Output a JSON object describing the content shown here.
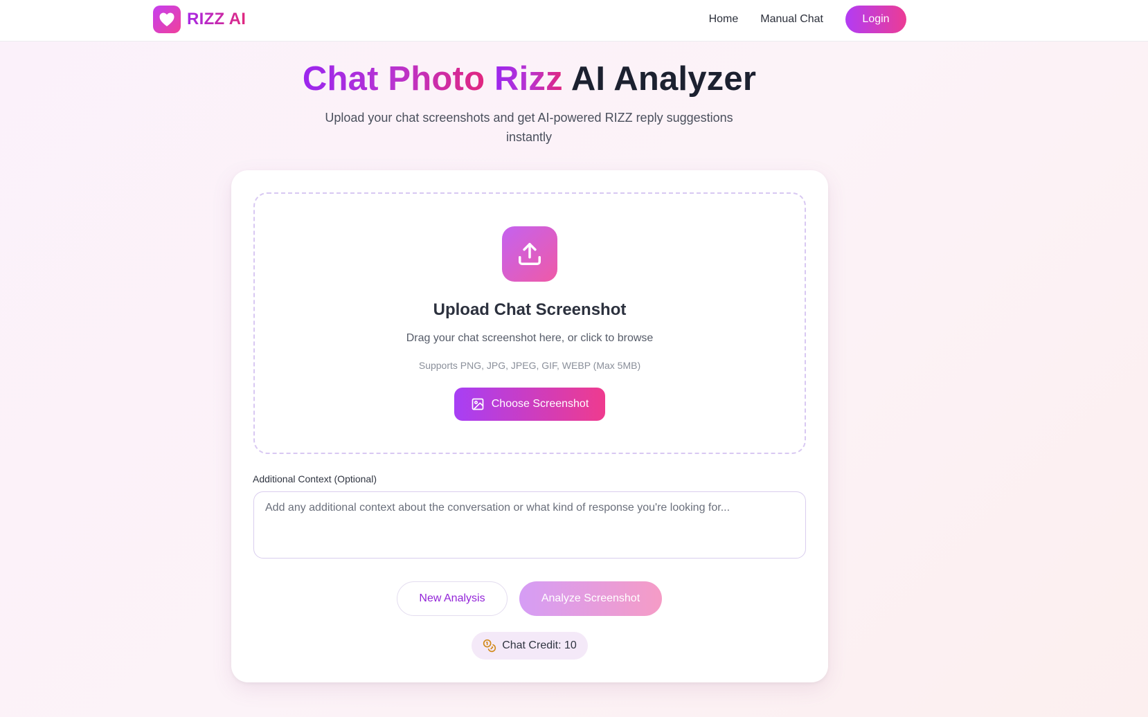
{
  "nav": {
    "brand": "RIZZ AI",
    "links": [
      "Home",
      "Manual Chat"
    ],
    "login": "Login"
  },
  "hero": {
    "title_highlight_1": "Chat Photo",
    "title_highlight_2": "Rizz",
    "title_rest": "AI Analyzer",
    "subtitle": "Upload your chat screenshots and get AI-powered RIZZ reply suggestions instantly"
  },
  "upload": {
    "icon": "upload-icon",
    "title": "Upload Chat Screenshot",
    "description": "Drag your chat screenshot here, or click to browse",
    "supports": "Supports PNG, JPG, JPEG, GIF, WEBP (Max 5MB)",
    "choose_label": "Choose Screenshot"
  },
  "context": {
    "label": "Additional Context (Optional)",
    "value": "",
    "placeholder": "Add any additional context about the conversation or what kind of response you're looking for..."
  },
  "actions": {
    "new_analysis": "New Analysis",
    "analyze": "Analyze Screenshot"
  },
  "credits": {
    "label": "Chat Credit: 10",
    "icon": "coins-icon"
  },
  "colors": {
    "accent_purple": "#a729e6",
    "accent_pink": "#e0297e",
    "credit_icon": "#d18a1a"
  }
}
